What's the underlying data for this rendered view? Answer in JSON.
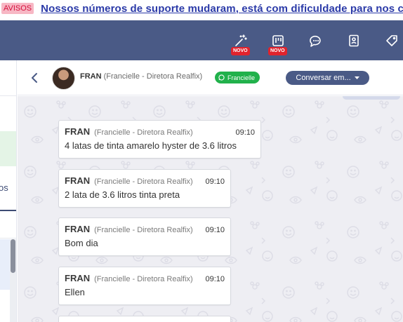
{
  "announcement": {
    "badge": "AVISOS",
    "message": "Nossos números de suporte mudaram, está com dificuldade para nos c"
  },
  "topnav": {
    "icons": [
      {
        "name": "magic-wand-icon",
        "new_badge": "NOVO"
      },
      {
        "name": "kanban-board-icon",
        "new_badge": "NOVO"
      },
      {
        "name": "chat-bubbles-icon"
      },
      {
        "name": "contact-card-icon"
      },
      {
        "name": "tag-icon"
      }
    ]
  },
  "left_panel": {
    "tab_label_fragment": "os"
  },
  "chat_header": {
    "contact_name": "FRAN",
    "contact_subtitle": "(Francielle - Diretora Realfix)",
    "channel_tag": "Francielle",
    "action_button": "Conversar em..."
  },
  "messages": [
    {
      "sender": "FRAN",
      "meta": "(Francielle - Diretora Realfix)",
      "time": "09:10",
      "text": "4 latas de tinta amarelo hyster de 3.6 litros"
    },
    {
      "sender": "FRAN",
      "meta": "(Francielle - Diretora Realfix)",
      "time": "09:10",
      "text": "2 lata de 3.6 litros tinta preta"
    },
    {
      "sender": "FRAN",
      "meta": "(Francielle - Diretora Realfix)",
      "time": "09:10",
      "text": "Bom dia"
    },
    {
      "sender": "FRAN",
      "meta": "(Francielle - Diretora Realfix)",
      "time": "09:10",
      "text": "Ellen"
    }
  ],
  "colors": {
    "nav": "#4a5a86",
    "chat_bg": "#eeeef3",
    "whatsapp_green": "#21b14b",
    "new_badge": "#e0232d"
  }
}
